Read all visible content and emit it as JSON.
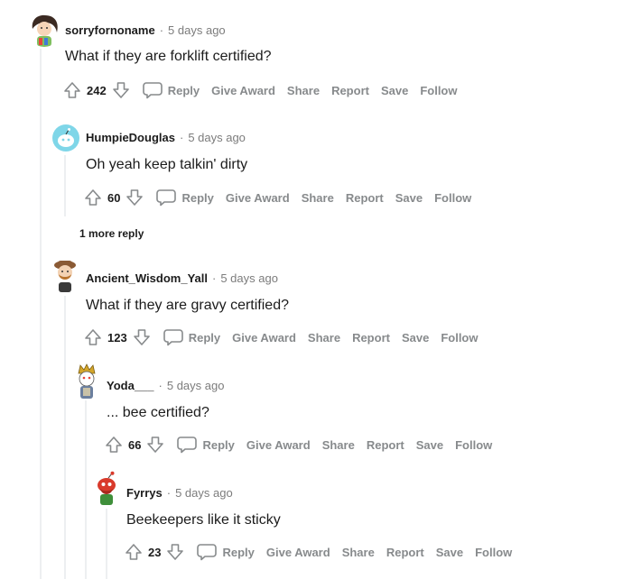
{
  "comments": [
    {
      "author": "sorryfornoname",
      "time": "5 days ago",
      "text": "What if they are forklift certified?",
      "score": "242",
      "avatar": "brown-hair-avatar"
    },
    {
      "author": "HumpieDouglas",
      "time": "5 days ago",
      "text": "Oh yeah keep talkin' dirty",
      "score": "60",
      "avatar": "default-snoo-avatar"
    },
    {
      "author": "Ancient_Wisdom_Yall",
      "time": "5 days ago",
      "text": "What if they are gravy certified?",
      "score": "123",
      "avatar": "hat-beard-avatar"
    },
    {
      "author": "Yoda___",
      "time": "5 days ago",
      "text": "... bee certified?",
      "score": "66",
      "avatar": "crowned-snoo-avatar"
    },
    {
      "author": "Fyrrys",
      "time": "5 days ago",
      "text": "Beekeepers like it sticky",
      "score": "23",
      "avatar": "red-snoo-avatar"
    }
  ],
  "actions": {
    "reply": "Reply",
    "give_award": "Give Award",
    "share": "Share",
    "report": "Report",
    "save": "Save",
    "follow": "Follow"
  },
  "more_replies": "1 more reply",
  "separator": "·",
  "icons": {
    "upvote": "upvote-arrow-icon",
    "downvote": "downvote-arrow-icon",
    "reply": "speech-bubble-icon"
  },
  "colors": {
    "meta": "#7c7c7c",
    "action": "#878a8c",
    "thread": "#edeff1"
  }
}
